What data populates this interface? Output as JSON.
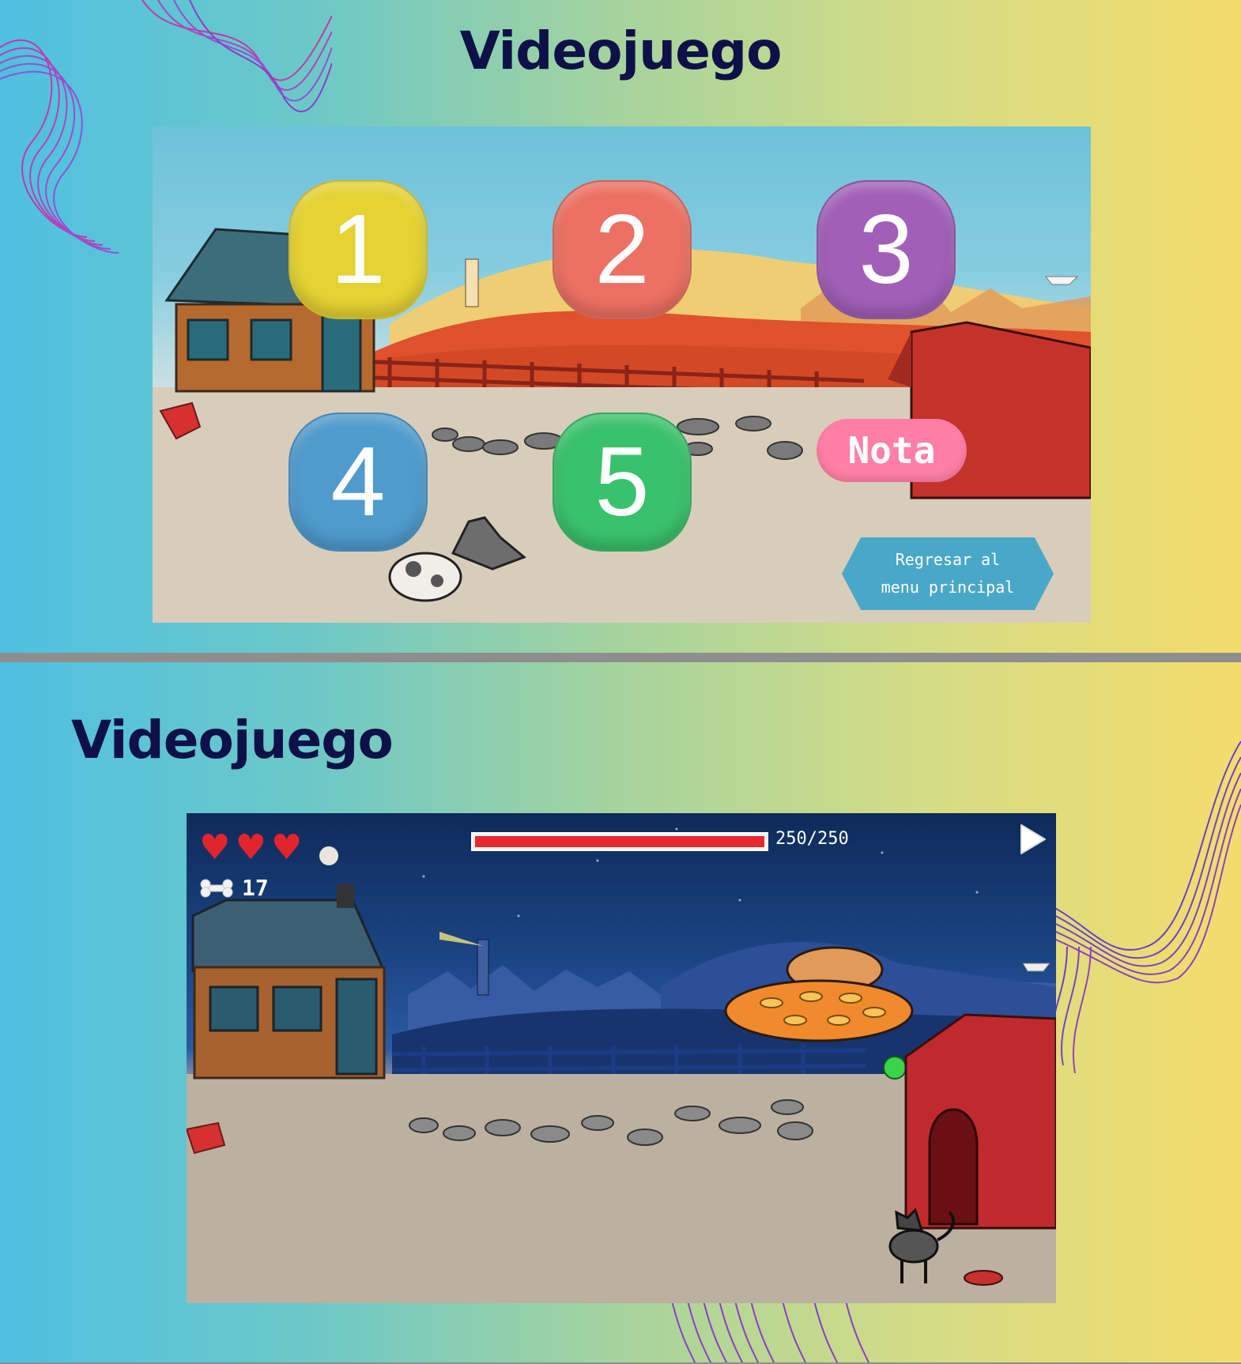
{
  "slides": [
    {
      "title": "Videojuego",
      "menu": {
        "levels": [
          {
            "label": "1",
            "color": "#e5d233"
          },
          {
            "label": "2",
            "color": "#ec7063"
          },
          {
            "label": "3",
            "color": "#a15fb8"
          },
          {
            "label": "4",
            "color": "#4f9bcd"
          },
          {
            "label": "5",
            "color": "#3ac16b"
          }
        ],
        "nota_label": "Nota",
        "back_label_line1": "Regresar al",
        "back_label_line2": "menu principal"
      }
    },
    {
      "title": "Videojuego",
      "hud": {
        "lives": 3,
        "bone_count": "17",
        "hp_text": "250/250",
        "hp_fraction": 1.0
      }
    }
  ],
  "colors": {
    "title": "#0e1148",
    "waves": "#8a3fc8",
    "heart": "#e2252d",
    "hp_bar": "#e8292f"
  },
  "icons": [
    "heart-icon",
    "moon-icon",
    "bone-icon",
    "play-icon",
    "ufo-icon",
    "dog-icon",
    "house-icon",
    "doghouse-icon"
  ]
}
